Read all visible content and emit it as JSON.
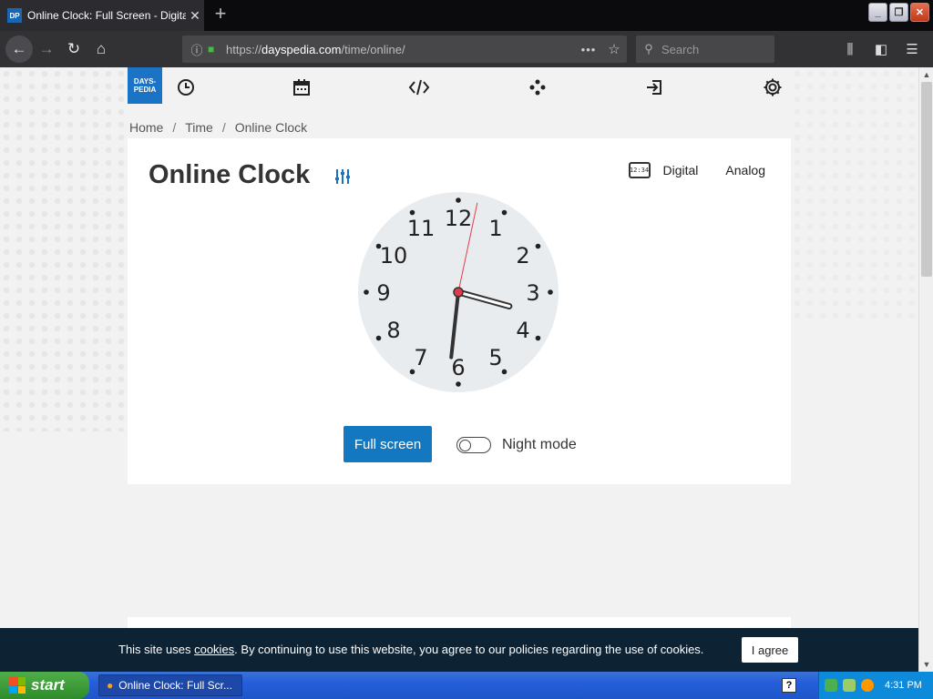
{
  "browser": {
    "tab_title": "Online Clock: Full Screen - Digital/A",
    "tab_favicon": "DP",
    "url_prefix": "https://",
    "url_domain": "dayspedia.com",
    "url_path": "/time/online/",
    "search_placeholder": "Search"
  },
  "site": {
    "logo_line1": "DAYS-",
    "logo_line2": "PEDIA",
    "nav_icons": [
      "clock-icon",
      "calendar-icon",
      "code-icon",
      "games-icon",
      "login-icon",
      "settings-icon"
    ]
  },
  "breadcrumb": [
    "Home",
    "Time",
    "Online Clock"
  ],
  "breadcrumb_sep": "/",
  "clock_card": {
    "title": "Online Clock",
    "digital_icon_text": "12:34",
    "mode_digital": "Digital",
    "mode_analog": "Analog",
    "fullscreen_label": "Full screen",
    "night_mode_label": "Night mode",
    "night_mode_on": false,
    "numerals": [
      "12",
      "1",
      "2",
      "3",
      "4",
      "5",
      "6",
      "7",
      "8",
      "9",
      "10",
      "11"
    ]
  },
  "clock_time": {
    "hour": 3,
    "minute": 31,
    "second": 2
  },
  "cookie_bar": {
    "text_before": "This site uses ",
    "link": "cookies",
    "text_after": ". By continuing to use this website, you agree to our policies regarding the use of cookies.",
    "agree_label": "I agree"
  },
  "taskbar": {
    "start_label": "start",
    "task_label": "Online Clock: Full Scr...",
    "time": "4:31 PM"
  },
  "colors": {
    "accent": "#1a73c4",
    "button": "#1478c0",
    "cookie_bg": "#0d2233",
    "second_hand": "#e33a4c"
  }
}
